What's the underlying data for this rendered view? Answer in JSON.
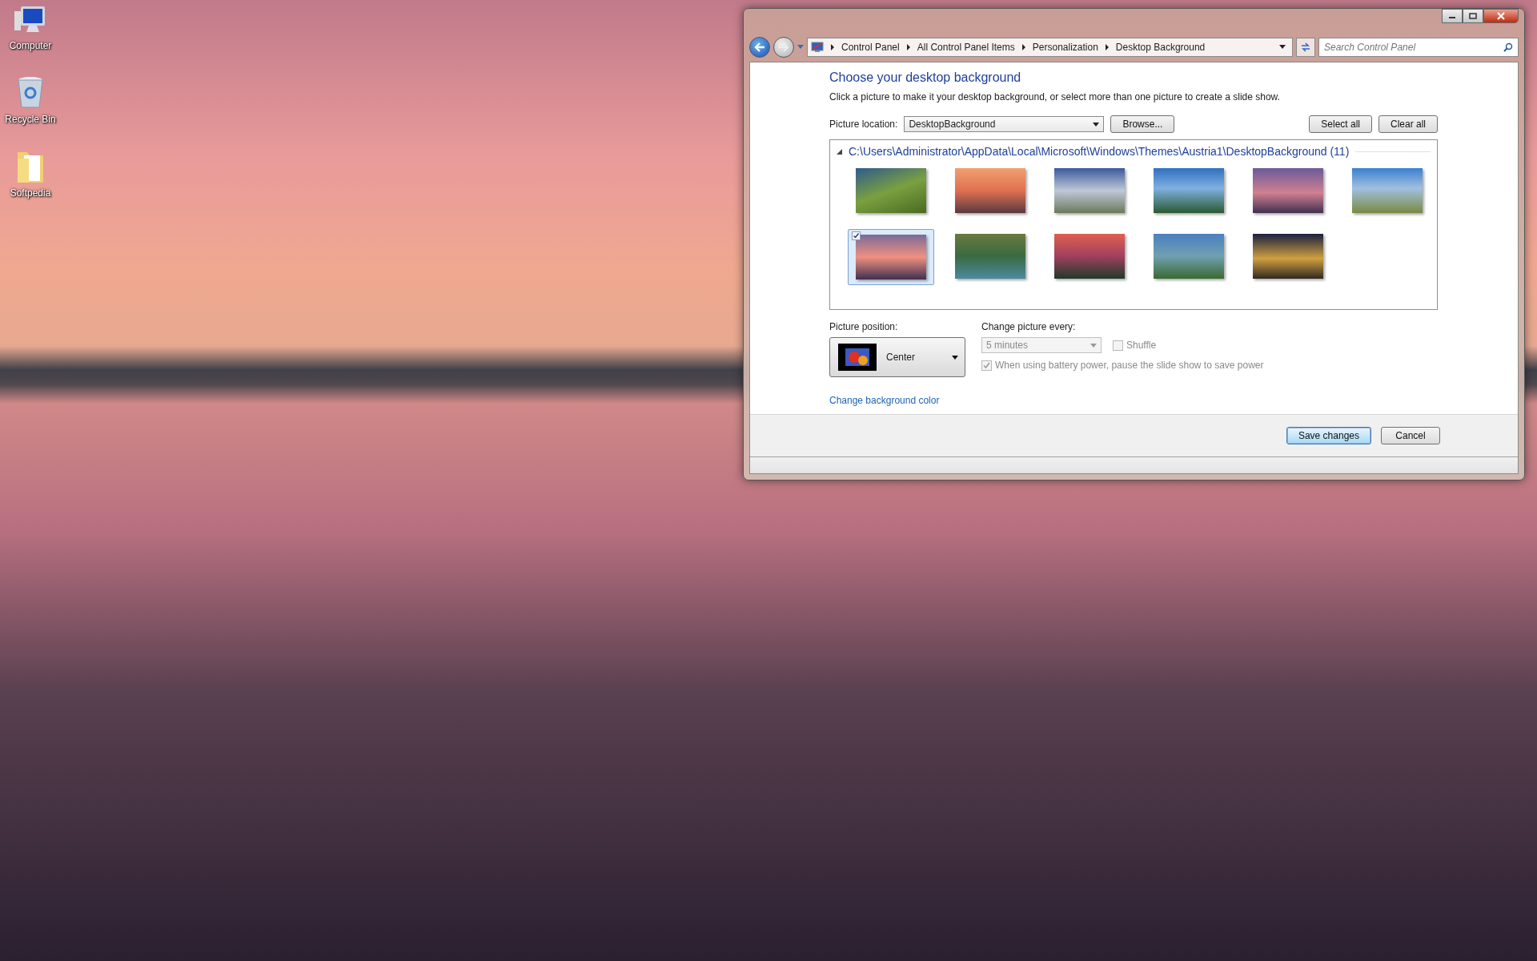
{
  "desktop_icons": [
    {
      "label": "Computer",
      "kind": "computer"
    },
    {
      "label": "Recycle Bin",
      "kind": "recycle"
    },
    {
      "label": "Softpedia",
      "kind": "folder"
    }
  ],
  "window": {
    "breadcrumb": [
      "Control Panel",
      "All Control Panel Items",
      "Personalization",
      "Desktop Background"
    ],
    "search": {
      "placeholder": "Search Control Panel"
    }
  },
  "heading": "Choose your desktop background",
  "description": "Click a picture to make it your desktop background, or select more than one picture to create a slide show.",
  "picture_location": {
    "label": "Picture location:",
    "value": "DesktopBackground"
  },
  "buttons": {
    "browse": "Browse...",
    "select_all": "Select all",
    "clear_all": "Clear all"
  },
  "group": {
    "path": "C:\\Users\\Administrator\\AppData\\Local\\Microsoft\\Windows\\Themes\\Austria1\\DesktopBackground (11)",
    "expanded": true,
    "pictures": [
      {
        "selected": false,
        "checked": false
      },
      {
        "selected": false,
        "checked": false
      },
      {
        "selected": false,
        "checked": false
      },
      {
        "selected": false,
        "checked": false
      },
      {
        "selected": false,
        "checked": false
      },
      {
        "selected": false,
        "checked": false
      },
      {
        "selected": true,
        "checked": true
      },
      {
        "selected": false,
        "checked": false
      },
      {
        "selected": false,
        "checked": false
      },
      {
        "selected": false,
        "checked": false
      },
      {
        "selected": false,
        "checked": false
      }
    ]
  },
  "picture_position": {
    "label": "Picture position:",
    "value": "Center"
  },
  "change_picture": {
    "label": "Change picture every:",
    "value": "5 minutes",
    "disabled": true
  },
  "shuffle": {
    "label": "Shuffle",
    "checked": false,
    "disabled": true
  },
  "battery": {
    "label": "When using battery power, pause the slide show to save power",
    "checked": true,
    "disabled": true
  },
  "link": "Change background color",
  "footer_buttons": [
    {
      "label": "Save changes",
      "kind": "default"
    },
    {
      "label": "Cancel",
      "kind": "normal"
    }
  ]
}
